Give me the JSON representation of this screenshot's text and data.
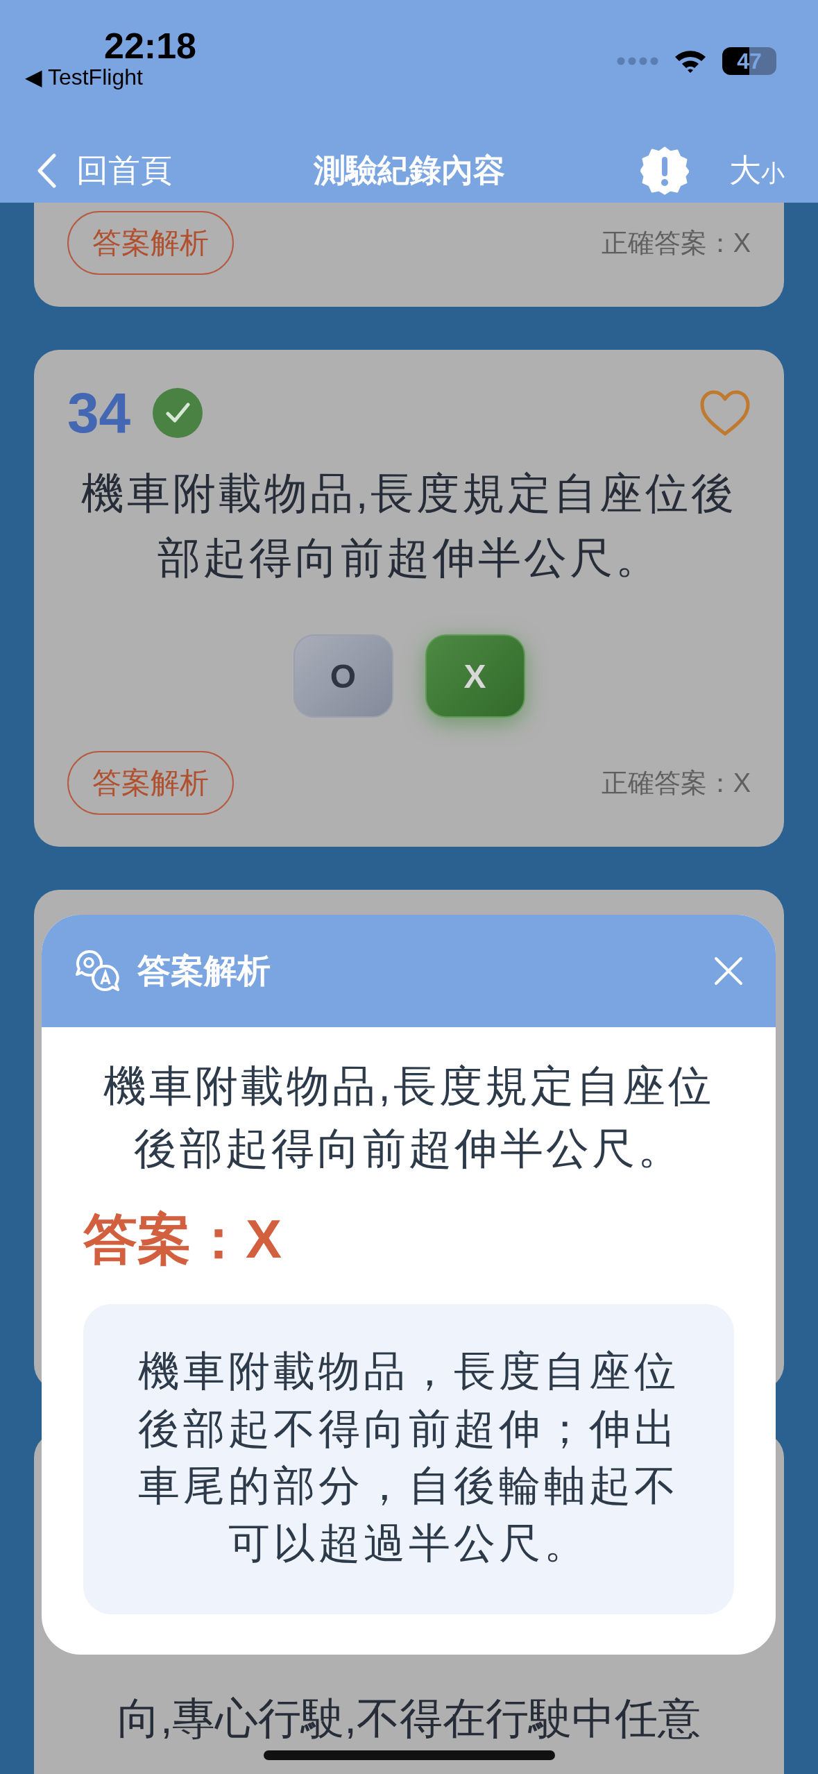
{
  "status_bar": {
    "time": "22:18",
    "back_app": "◀ TestFlight",
    "battery": "47"
  },
  "nav": {
    "back": "回首頁",
    "title": "測驗紀錄內容",
    "font_size": {
      "big": "大",
      "small": "小"
    }
  },
  "cards": [
    {
      "kind": "footer_only",
      "analysis_button": "答案解析",
      "correct_answer": "正確答案：X"
    },
    {
      "kind": "full",
      "number": "34",
      "correct": true,
      "favorite": false,
      "question": "機車附載物品,長度規定自座位後部起得向前超伸半公尺。",
      "options": [
        {
          "label": "O",
          "selected": false
        },
        {
          "label": "X",
          "selected": true
        }
      ],
      "analysis_button": "答案解析",
      "correct_answer": "正確答案：X"
    },
    {
      "kind": "blank"
    },
    {
      "kind": "text_only",
      "lines": [
        "向,專心行駛,不得在行駛中任意"
      ]
    }
  ],
  "modal": {
    "title": "答案解析",
    "question": "機車附載物品,長度規定自座位後部起得向前超伸半公尺。",
    "answer": "答案：X",
    "explanation": "機車附載物品，長度自座位後部起不得向前超伸；伸出車尾的部分，自後輪軸起不可以超過半公尺。"
  }
}
